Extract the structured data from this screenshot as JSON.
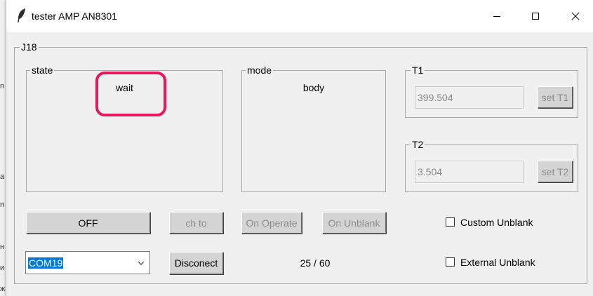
{
  "window": {
    "title": "tester AMP AN8301",
    "controls": {
      "minimize": "minimize",
      "maximize": "maximize",
      "close": "close"
    }
  },
  "background_window_glyphs": [
    "n",
    "a",
    "п",
    "н",
    "и",
    "ж"
  ],
  "device_frame": {
    "label": "J18"
  },
  "state_panel": {
    "label": "state",
    "value": "wait"
  },
  "mode_panel": {
    "label": "mode",
    "value": "body"
  },
  "t1": {
    "label": "T1",
    "value": "399.504",
    "button": "set T1"
  },
  "t2": {
    "label": "T2",
    "value": "3.504",
    "button": "set T2"
  },
  "buttons": {
    "off": "OFF",
    "ch_to": "ch to",
    "on_operate": "On Operate",
    "on_unblank": "On Unblank",
    "disconnect": "Disconect"
  },
  "checkboxes": {
    "custom_unblank": {
      "label": "Custom Unblank",
      "checked": false
    },
    "external_unblank": {
      "label": "External Unblank",
      "checked": false
    }
  },
  "port": {
    "selected": "COM19"
  },
  "counter": "25 / 60",
  "colors": {
    "highlight": "#e6195f",
    "selection": "#0078d7",
    "window_bg": "#f0f0f0"
  }
}
